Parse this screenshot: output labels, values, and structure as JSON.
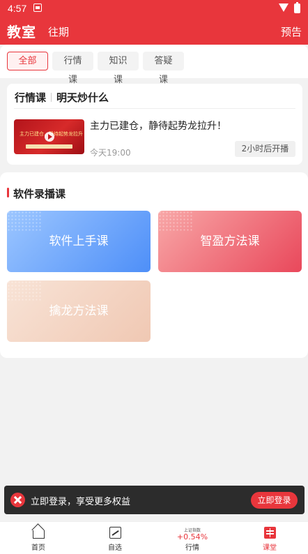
{
  "status_bar": {
    "time": "4:57"
  },
  "header": {
    "title": "教室",
    "past": "往期",
    "preview": "预告"
  },
  "filters": [
    {
      "label": "全部",
      "active": true
    },
    {
      "label": "行情课",
      "active": false
    },
    {
      "label": "知识课",
      "active": false
    },
    {
      "label": "答疑课",
      "active": false
    }
  ],
  "live": {
    "category": "行情课",
    "topic": "明天炒什么",
    "thumb_caption": "主力已建仓，静待起势龙拉升",
    "title": "主力已建仓，静待起势龙拉升！",
    "time": "今天19:00",
    "badge": "2小时后开播"
  },
  "courses": {
    "section_title": "软件录播课",
    "items": [
      {
        "label": "软件上手课"
      },
      {
        "label": "智盈方法课"
      },
      {
        "label": "擒龙方法课"
      }
    ]
  },
  "login_bar": {
    "text": "立即登录，享受更多权益",
    "button": "立即登录"
  },
  "tabbar": {
    "home": "首页",
    "watchlist": "自选",
    "market_index": "上证指数",
    "market_change": "+0.54%",
    "market": "行情",
    "classroom": "课堂"
  },
  "colors": {
    "brand_red": "#e8363c",
    "blue_card": "#4e8ff8",
    "pink_card": "#e9485b",
    "peach_card": "#f0c8b3"
  }
}
